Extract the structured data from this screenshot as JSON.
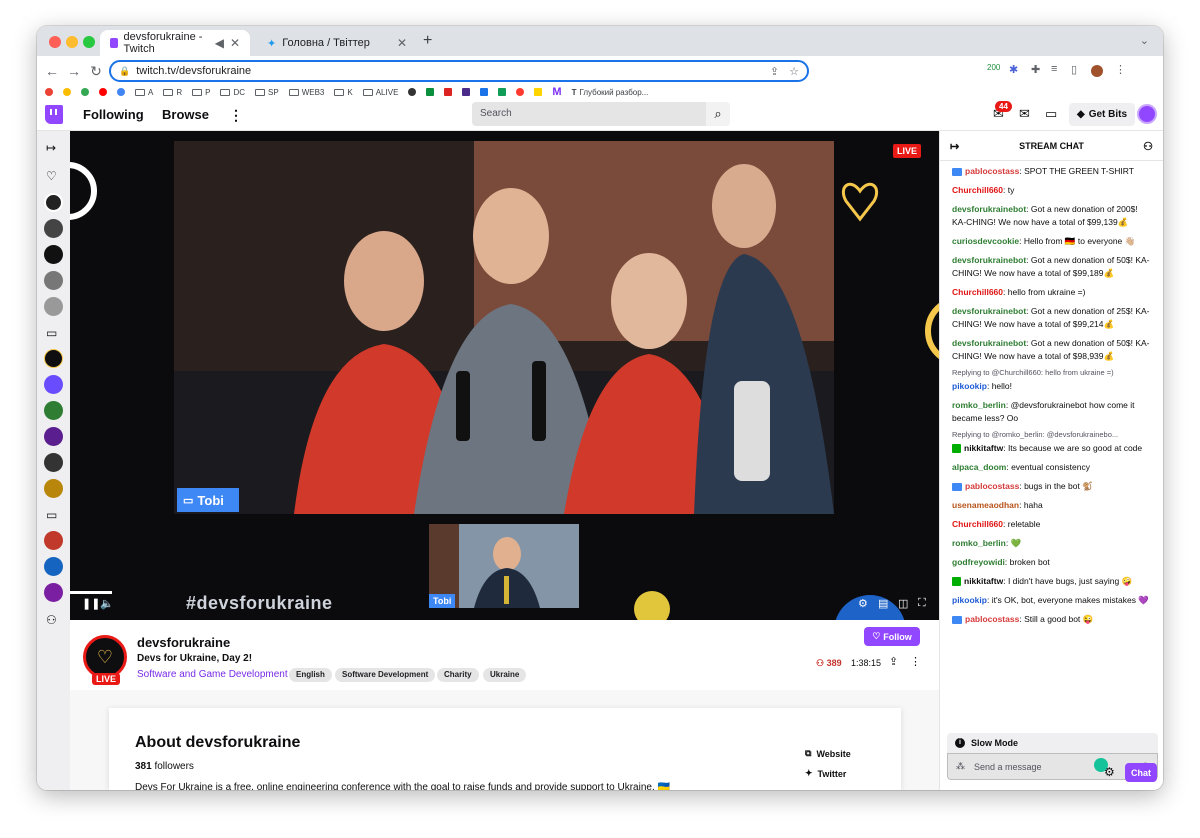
{
  "browser": {
    "tabs": [
      {
        "title": "devsforukraine - Twitch",
        "active": true
      },
      {
        "title": "Головна / Твіттер",
        "active": false
      }
    ],
    "url": "twitch.tv/devsforukraine",
    "extension_badge": "200",
    "bookmarks": [
      "A",
      "R",
      "P",
      "DC",
      "SP",
      "WEB3",
      "K",
      "ALIVE",
      "Глубокий разбор..."
    ]
  },
  "header": {
    "following": "Following",
    "browse": "Browse",
    "search_placeholder": "Search",
    "notifications_count": "44",
    "get_bits": "Get Bits"
  },
  "video": {
    "live": "LIVE",
    "speaker_label": "Tobi",
    "pip_label": "Tobi",
    "hashtag": "#devsforukraine"
  },
  "channel": {
    "name": "devsforukraine",
    "title": "Devs for Ukraine, Day 2!",
    "category": "Software and Game Development",
    "tags": [
      "English",
      "Software Development",
      "Charity",
      "Ukraine"
    ],
    "follow": "Follow",
    "viewers": "389",
    "uptime": "1:38:15",
    "live": "LIVE"
  },
  "about": {
    "title": "About devsforukraine",
    "followers_count": "381",
    "followers_label": "followers",
    "description": "Devs For Ukraine is a free, online engineering conference with the goal to raise funds and provide support to Ukraine. 🇺🇦",
    "links": [
      "Website",
      "Twitter"
    ]
  },
  "chat": {
    "header": "STREAM CHAT",
    "messages": [
      {
        "user": "pablocostass",
        "color": "#d63a3a",
        "badge": "mod",
        "text": "SPOT THE GREEN T-SHIRT"
      },
      {
        "user": "Churchill660",
        "color": "#e01515",
        "badge": "",
        "text": "ty"
      },
      {
        "user": "devsforukrainebot",
        "color": "#2e7d32",
        "badge": "",
        "text": "Got a new donation of 200$! KA-CHING! We now have a total of $99,139💰"
      },
      {
        "user": "curiosdevcookie",
        "color": "#2e7d32",
        "badge": "",
        "text": "Hello from 🇩🇪 to everyone 👋🏼"
      },
      {
        "user": "devsforukrainebot",
        "color": "#2e7d32",
        "badge": "",
        "text": "Got a new donation of 50$! KA-CHING! We now have a total of $99,189💰"
      },
      {
        "user": "Churchill660",
        "color": "#e01515",
        "badge": "",
        "text": "hello from ukraine =)"
      },
      {
        "user": "devsforukrainebot",
        "color": "#2e7d32",
        "badge": "",
        "text": "Got a new donation of 25$! KA-CHING! We now have a total of $99,214💰"
      },
      {
        "user": "devsforukrainebot",
        "color": "#2e7d32",
        "badge": "",
        "text": "Got a new donation of 50$! KA-CHING! We now have a total of $98,939💰"
      },
      {
        "reply": "Replying to @Churchill660: hello from ukraine =)",
        "user": "pikookip",
        "color": "#1e5bd6",
        "badge": "",
        "text": "hello!"
      },
      {
        "user": "romko_berlin",
        "color": "#2e7d32",
        "badge": "",
        "text": "@devsforukrainebot how come it became less? Oo"
      },
      {
        "reply": "Replying to @romko_berlin: @devsforukrainebo...",
        "user": "nikkitaftw",
        "color": "#0e0e10",
        "badge": "ver",
        "text": "Its because we are so good at code"
      },
      {
        "user": "alpaca_doom",
        "color": "#2e7d32",
        "badge": "",
        "text": "eventual consistency"
      },
      {
        "user": "pablocostass",
        "color": "#d63a3a",
        "badge": "mod",
        "text": "bugs in the bot 🐒"
      },
      {
        "user": "usenameaodhan",
        "color": "#b8541c",
        "badge": "",
        "text": "haha"
      },
      {
        "user": "Churchill660",
        "color": "#e01515",
        "badge": "",
        "text": "reletable"
      },
      {
        "user": "romko_berlin",
        "color": "#2e7d32",
        "badge": "",
        "text": "💚"
      },
      {
        "user": "godfreyowidi",
        "color": "#2e7d32",
        "badge": "",
        "text": "broken bot"
      },
      {
        "user": "nikkitaftw",
        "color": "#0e0e10",
        "badge": "ver",
        "text": "I didn't have bugs, just saying 🤪"
      },
      {
        "user": "pikookip",
        "color": "#1e5bd6",
        "badge": "",
        "text": "it's OK, bot, everyone makes mistakes 💜"
      },
      {
        "user": "pablocostass",
        "color": "#d63a3a",
        "badge": "mod",
        "text": "Still a good bot 😜"
      }
    ],
    "slow_mode": "Slow Mode",
    "input_placeholder": "Send a message",
    "chat_button": "Chat"
  }
}
